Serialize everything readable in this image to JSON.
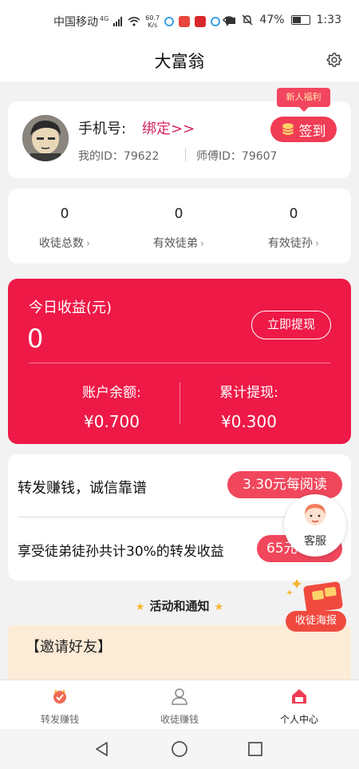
{
  "status_bar": {
    "carrier": "中国移动",
    "network": "4G",
    "speed": "60.7",
    "speed_unit": "K/s",
    "battery": "47%",
    "time": "1:33"
  },
  "header": {
    "title": "大富翁"
  },
  "profile": {
    "phone_label": "手机号:",
    "bind_link": "绑定>>",
    "my_id": "我的ID：79622",
    "master_id": "师傅ID：79607",
    "newbie_badge": "新人福利",
    "signin_label": "签到"
  },
  "stats": [
    {
      "value": "0",
      "label": "收徒总数"
    },
    {
      "value": "0",
      "label": "有效徒弟"
    },
    {
      "value": "0",
      "label": "有效徒孙"
    }
  ],
  "earnings": {
    "title": "今日收益(元)",
    "today": "0",
    "withdraw_label": "立即提现",
    "balance_label": "账户余额:",
    "balance_value": "¥0.700",
    "total_label": "累计提现:",
    "total_value": "¥0.300"
  },
  "promo": {
    "line1": "转发赚钱，诚信靠谱",
    "pill1": "3.30元每阅读",
    "line2": "享受徒弟徒孙共计30%的转发收益",
    "pill2": "65元每位"
  },
  "floating": {
    "service_label": "客服",
    "poster_label": "收徒海报"
  },
  "activity": {
    "title": "活动和通知",
    "invite_title": "【邀请好友】"
  },
  "bottom_nav": {
    "items": [
      {
        "label": "转发赚钱"
      },
      {
        "label": "收徒赚钱"
      },
      {
        "label": "个人中心"
      }
    ]
  },
  "colors": {
    "accent": "#ee1947",
    "pill": "#f0475c",
    "link": "#d62463",
    "invite_bg": "#fcebd6"
  }
}
